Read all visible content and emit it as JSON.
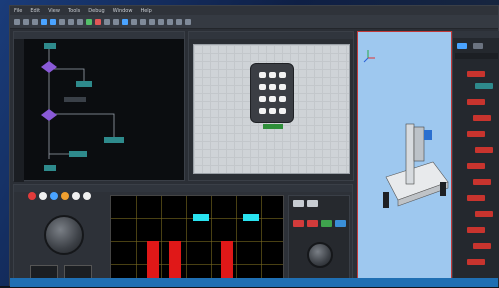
{
  "window": {
    "menu_items": [
      "File",
      "Edit",
      "View",
      "Tools",
      "Debug",
      "Window",
      "Help"
    ]
  },
  "colors": {
    "accent": "#4aa3ff",
    "signal_red": "#e01818",
    "signal_cyan": "#29e3f0",
    "block_red": "#c8342e",
    "block_teal": "#2e8a8c",
    "block_purple": "#8a5ad8"
  },
  "icons": {
    "keypad": "keypad-icon",
    "knob": "rotary-knob-icon",
    "axis": "axis-gizmo-icon"
  }
}
